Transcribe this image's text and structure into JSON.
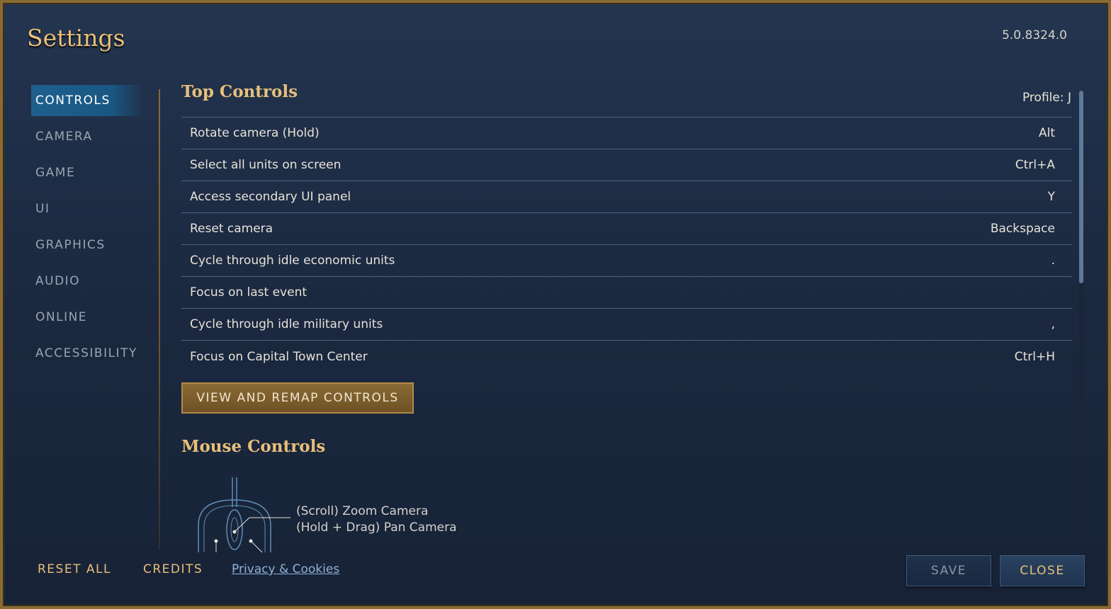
{
  "header": {
    "title": "Settings",
    "version": "5.0.8324.0"
  },
  "sidebar": {
    "items": [
      {
        "label": "CONTROLS",
        "active": true
      },
      {
        "label": "CAMERA",
        "active": false
      },
      {
        "label": "GAME",
        "active": false
      },
      {
        "label": "UI",
        "active": false
      },
      {
        "label": "GRAPHICS",
        "active": false
      },
      {
        "label": "AUDIO",
        "active": false
      },
      {
        "label": "ONLINE",
        "active": false
      },
      {
        "label": "ACCESSIBILITY",
        "active": false
      }
    ]
  },
  "top_controls": {
    "title": "Top Controls",
    "profile": "Profile: J",
    "rows": [
      {
        "action": "Rotate camera (Hold)",
        "key": "Alt"
      },
      {
        "action": "Select all units on screen",
        "key": "Ctrl+A"
      },
      {
        "action": "Access secondary UI panel",
        "key": "Y"
      },
      {
        "action": "Reset camera",
        "key": "Backspace"
      },
      {
        "action": "Cycle through idle economic units",
        "key": "."
      },
      {
        "action": "Focus on last event",
        "key": ""
      },
      {
        "action": "Cycle through idle military units",
        "key": ","
      },
      {
        "action": "Focus on Capital Town Center",
        "key": "Ctrl+H"
      }
    ],
    "remap_label": "VIEW AND REMAP CONTROLS"
  },
  "mouse_controls": {
    "title": "Mouse Controls",
    "scroll_label": "(Scroll) Zoom Camera",
    "drag_label": "(Hold + Drag) Pan Camera"
  },
  "footer": {
    "reset_all": "RESET ALL",
    "credits": "CREDITS",
    "privacy": "Privacy & Cookies",
    "save": "SAVE",
    "close": "CLOSE"
  },
  "colors": {
    "accent_gold": "#e8c07a",
    "active_tab": "#1e5f8e",
    "link": "#8fb2d8"
  }
}
